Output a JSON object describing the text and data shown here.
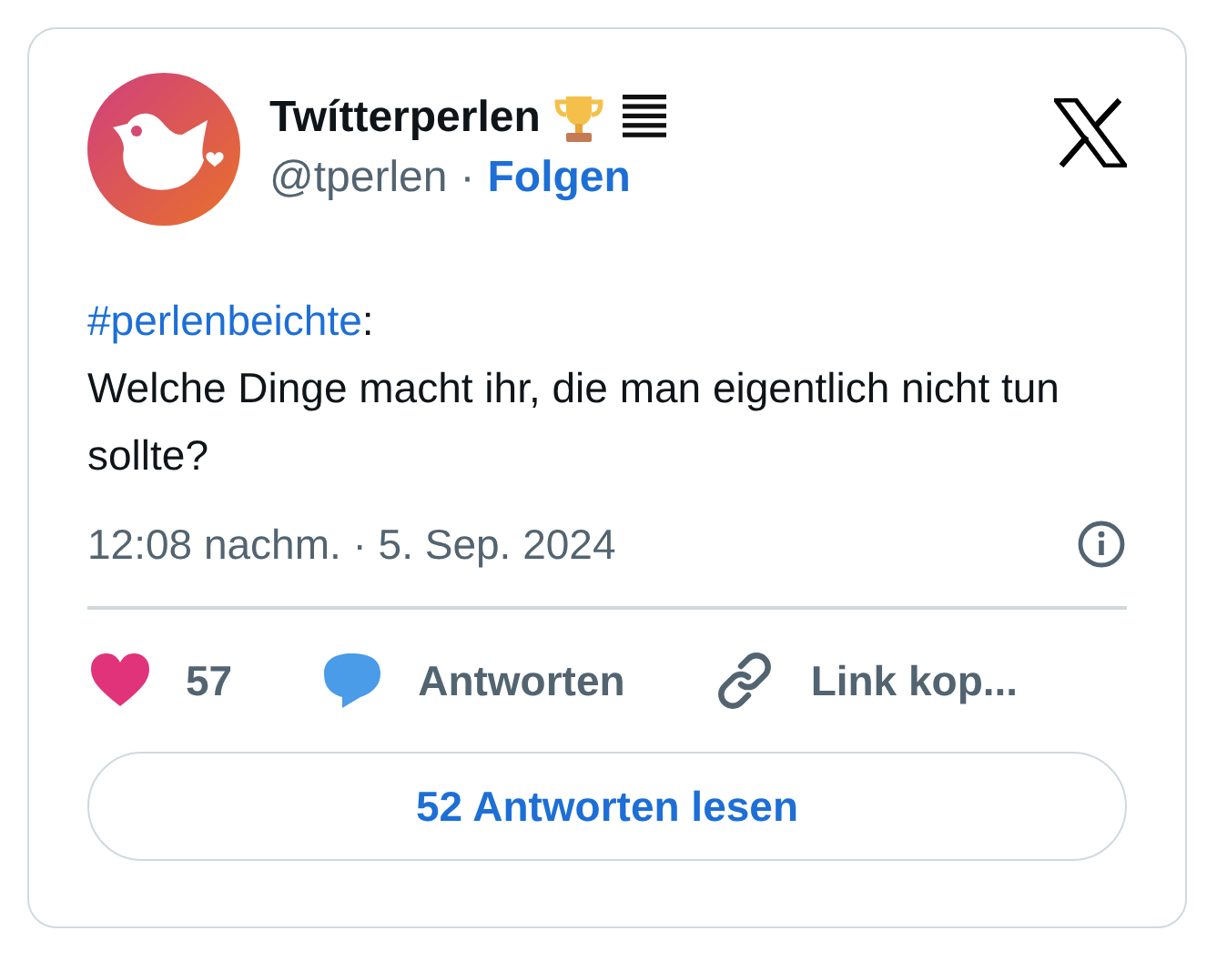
{
  "author": {
    "name": "Twítterperlen",
    "handle": "@tperlen",
    "separator": "·",
    "follow": "Folgen"
  },
  "body": {
    "hashtag": "#perlenbeichte",
    "suffix": ":",
    "text": "Welche Dinge macht ihr, die man eigentlich nicht tun sollte?"
  },
  "timestamp": "12:08 nachm. · 5. Sep. 2024",
  "actions": [
    {
      "kind": "like",
      "label": "57"
    },
    {
      "kind": "reply",
      "label": "Antworten"
    },
    {
      "kind": "copy",
      "label": "Link kop..."
    }
  ],
  "read_replies": "52 Antworten lesen"
}
